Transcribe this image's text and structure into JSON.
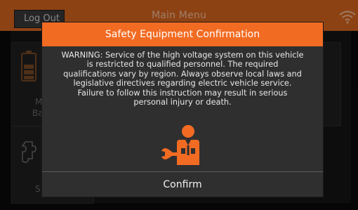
{
  "header": {
    "logout_label": "Log Out",
    "title": "Main Menu",
    "wifi_icon": "wifi-icon"
  },
  "tiles": [
    {
      "icon": "battery-icon",
      "label_line1": "M",
      "label_line2": "Ba"
    },
    {
      "icon": "puzzle-icon",
      "label": "S"
    }
  ],
  "modal": {
    "title": "Safety Equipment Confirmation",
    "warning_lines": [
      "WARNING: Service of the high voltage system on this vehicle",
      "is restricted to qualified personnel. The required",
      "qualifications vary by region. Always observe local laws and",
      "legislative directives regarding electric vehicle service.",
      "Failure to follow this instruction may result in serious",
      "personal injury or death."
    ],
    "icon": "technician-wrench-icon",
    "confirm_label": "Confirm"
  },
  "colors": {
    "accent": "#f26b22",
    "topbar": "#d9661f",
    "modal_bg": "#2f2f2f"
  }
}
